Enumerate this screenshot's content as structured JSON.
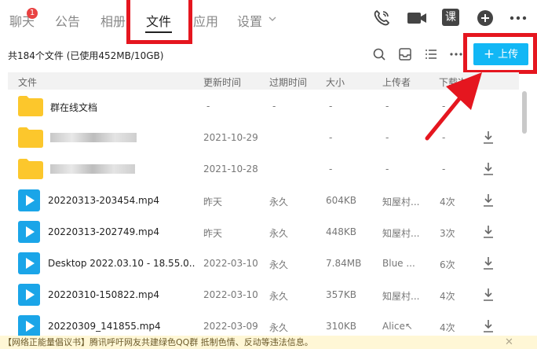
{
  "nav": {
    "tabs": [
      {
        "label": "聊天"
      },
      {
        "label": "公告"
      },
      {
        "label": "相册"
      },
      {
        "label": "文件"
      },
      {
        "label": "应用"
      },
      {
        "label": "设置"
      }
    ],
    "chat_badge": "1",
    "icons": [
      "phone-icon",
      "video-call-icon",
      "course-icon",
      "add-icon",
      "more-icon"
    ],
    "course_label": "课"
  },
  "toolbar": {
    "summary": "共184个文件 (已使用452MB/10GB)",
    "upload_label": "上传",
    "icons": [
      "search-icon",
      "inbox-icon",
      "list-view-icon",
      "more-icon"
    ]
  },
  "table": {
    "headers": [
      "文件",
      "更新时间",
      "过期时间",
      "大小",
      "上传者",
      "下载次数"
    ],
    "rows": [
      {
        "type": "folder",
        "name": "群在线文档",
        "updated": "-",
        "expires": "-",
        "size": "-",
        "uploader": "-",
        "downloads": "-",
        "redacted": false,
        "download": false
      },
      {
        "type": "folder",
        "name": "",
        "updated": "2021-10-29",
        "expires": "",
        "size": "-",
        "uploader": "-",
        "downloads": "-",
        "redacted": true,
        "download": true
      },
      {
        "type": "folder",
        "name": "",
        "updated": "2021-10-28",
        "expires": "",
        "size": "-",
        "uploader": "-",
        "downloads": "-",
        "redacted": true,
        "download": true
      },
      {
        "type": "video",
        "name": "20220313-203454.mp4",
        "updated": "昨天",
        "expires": "永久",
        "size": "604KB",
        "uploader": "知屋村...",
        "downloads": "4次",
        "redacted": false,
        "download": true
      },
      {
        "type": "video",
        "name": "20220313-202749.mp4",
        "updated": "昨天",
        "expires": "永久",
        "size": "448KB",
        "uploader": "知屋村...",
        "downloads": "3次",
        "redacted": false,
        "download": true
      },
      {
        "type": "video",
        "name": "Desktop 2022.03.10 - 18.55.0...",
        "updated": "2022-03-10",
        "expires": "永久",
        "size": "7.84MB",
        "uploader": "Blue ...",
        "downloads": "6次",
        "redacted": false,
        "download": true
      },
      {
        "type": "video",
        "name": "20220310-150822.mp4",
        "updated": "2022-03-10",
        "expires": "永久",
        "size": "357KB",
        "uploader": "知屋村...",
        "downloads": "4次",
        "redacted": false,
        "download": true
      },
      {
        "type": "video",
        "name": "20220309_141855.mp4",
        "updated": "2022-03-09",
        "expires": "永久",
        "size": "310KB",
        "uploader": "Alice↖",
        "downloads": "4次",
        "redacted": false,
        "download": true
      }
    ]
  },
  "notice": {
    "text": "【网络正能量倡议书】腾讯呼吁网友共建绿色QQ群 抵制色情、反动等违法信息。",
    "close": "✕"
  },
  "colors": {
    "accent": "#12b7f5",
    "highlight": "#e5161f",
    "video_icon": "#1aa5e8",
    "folder": "#fcc72c"
  }
}
